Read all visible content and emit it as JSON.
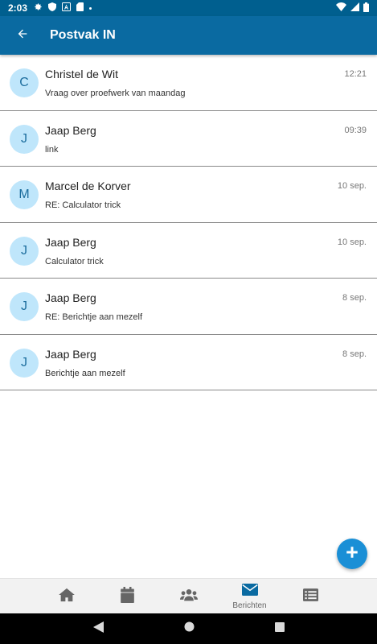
{
  "status_bar": {
    "time": "2:03",
    "icons_left": [
      "gear-icon",
      "shield-icon",
      "a-box-icon",
      "sd-card-icon",
      "dot-icon"
    ],
    "icons_right": [
      "wifi-icon",
      "signal-icon",
      "battery-icon"
    ]
  },
  "app_bar": {
    "title": "Postvak IN",
    "back_icon": "arrow-left-icon"
  },
  "colors": {
    "status_bar": "#005f8f",
    "app_bar": "#0a6aa1",
    "avatar_bg": "#bfe6fb",
    "avatar_text": "#1d6e9e",
    "fab": "#1a8fd6",
    "nav_active": "#0a6aa1"
  },
  "messages": [
    {
      "initial": "C",
      "sender": "Christel de Wit",
      "subject": "Vraag over proefwerk van maandag",
      "date": "12:21"
    },
    {
      "initial": "J",
      "sender": "Jaap Berg",
      "subject": "link",
      "date": "09:39"
    },
    {
      "initial": "M",
      "sender": "Marcel de Korver",
      "subject": "RE: Calculator trick",
      "date": "10 sep."
    },
    {
      "initial": "J",
      "sender": "Jaap Berg",
      "subject": "Calculator trick",
      "date": "10 sep."
    },
    {
      "initial": "J",
      "sender": "Jaap Berg",
      "subject": "RE: Berichtje aan mezelf",
      "date": "8 sep."
    },
    {
      "initial": "J",
      "sender": "Jaap Berg",
      "subject": "Berichtje aan mezelf",
      "date": "8 sep."
    }
  ],
  "fab": {
    "icon": "plus-icon"
  },
  "bottom_nav": [
    {
      "icon": "home-icon",
      "label": ""
    },
    {
      "icon": "calendar-icon",
      "label": ""
    },
    {
      "icon": "users-icon",
      "label": ""
    },
    {
      "icon": "envelope-icon",
      "label": "Berichten",
      "active": true
    },
    {
      "icon": "list-icon",
      "label": ""
    }
  ],
  "system_nav": [
    "back-triangle-icon",
    "home-circle-icon",
    "recents-square-icon"
  ]
}
